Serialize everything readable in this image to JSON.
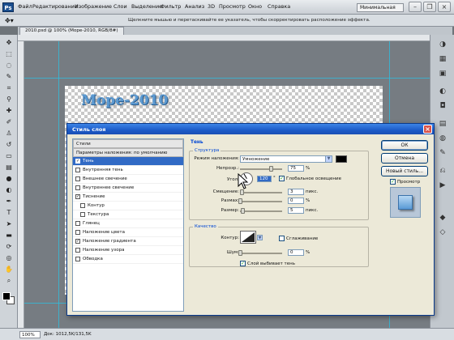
{
  "app": {
    "logo": "Ps",
    "menu": [
      "Файл",
      "Редактирование",
      "Изображение",
      "Слои",
      "Выделение",
      "Фильтр",
      "Анализ",
      "3D",
      "Просмотр",
      "Окно",
      "Справка"
    ],
    "workspace": "Минимальная"
  },
  "options_bar": {
    "hint": "Щелкните мышью и перетаскивайте ее указатель, чтобы скорректировать расположение эффекта."
  },
  "document": {
    "tab_label": "2010.psd @ 100% (Море-2010, RGB/8#)",
    "canvas_text": "Море-2010"
  },
  "status": {
    "zoom": "100%",
    "doc_info": "Док: 1012,5K/131,5K"
  },
  "dialog": {
    "title": "Стиль слоя",
    "styles_header": "Стили",
    "blending_options": "Параметры наложения: по умолчанию",
    "styles": [
      {
        "label": "Тень",
        "checked": true,
        "selected": true,
        "indent": false
      },
      {
        "label": "Внутренняя тень",
        "checked": false,
        "selected": false,
        "indent": false
      },
      {
        "label": "Внешнее свечение",
        "checked": false,
        "selected": false,
        "indent": false
      },
      {
        "label": "Внутреннее свечение",
        "checked": false,
        "selected": false,
        "indent": false
      },
      {
        "label": "Тиснение",
        "checked": true,
        "selected": false,
        "indent": false
      },
      {
        "label": "Контур",
        "checked": false,
        "selected": false,
        "indent": true
      },
      {
        "label": "Текстура",
        "checked": false,
        "selected": false,
        "indent": true
      },
      {
        "label": "Глянец",
        "checked": false,
        "selected": false,
        "indent": false
      },
      {
        "label": "Наложение цвета",
        "checked": false,
        "selected": false,
        "indent": false
      },
      {
        "label": "Наложение градиента",
        "checked": true,
        "selected": false,
        "indent": false
      },
      {
        "label": "Наложение узора",
        "checked": false,
        "selected": false,
        "indent": false
      },
      {
        "label": "Обводка",
        "checked": false,
        "selected": false,
        "indent": false
      }
    ],
    "shadow": {
      "section_title": "Тень",
      "structure_legend": "Структура",
      "blend_mode_label": "Режим наложения:",
      "blend_mode_value": "Умножение",
      "opacity_label": "Непрозр.:",
      "opacity_value": "75",
      "opacity_fraction": 0.75,
      "angle_label": "Угол:",
      "angle_value": "120",
      "global_light_label": "Глобальное освещение",
      "global_light_checked": true,
      "offset_label": "Смещение:",
      "offset_value": "3",
      "spread_label": "Размах:",
      "spread_value": "0",
      "size_label": "Размер:",
      "size_value": "5",
      "unit_px": "пикс.",
      "unit_percent": "%",
      "shadow_color": "#000000"
    },
    "quality": {
      "legend": "Качество",
      "contour_label": "Контур:",
      "antialias_label": "Сглаживание",
      "antialias_checked": false,
      "noise_label": "Шум:",
      "noise_value": "0",
      "knockout_label": "Слой выбивает тень",
      "knockout_checked": true
    },
    "buttons": {
      "ok": "ОК",
      "cancel": "Отмена",
      "new_style": "Новый стиль...",
      "preview_label": "Просмотр",
      "preview_checked": true
    }
  }
}
